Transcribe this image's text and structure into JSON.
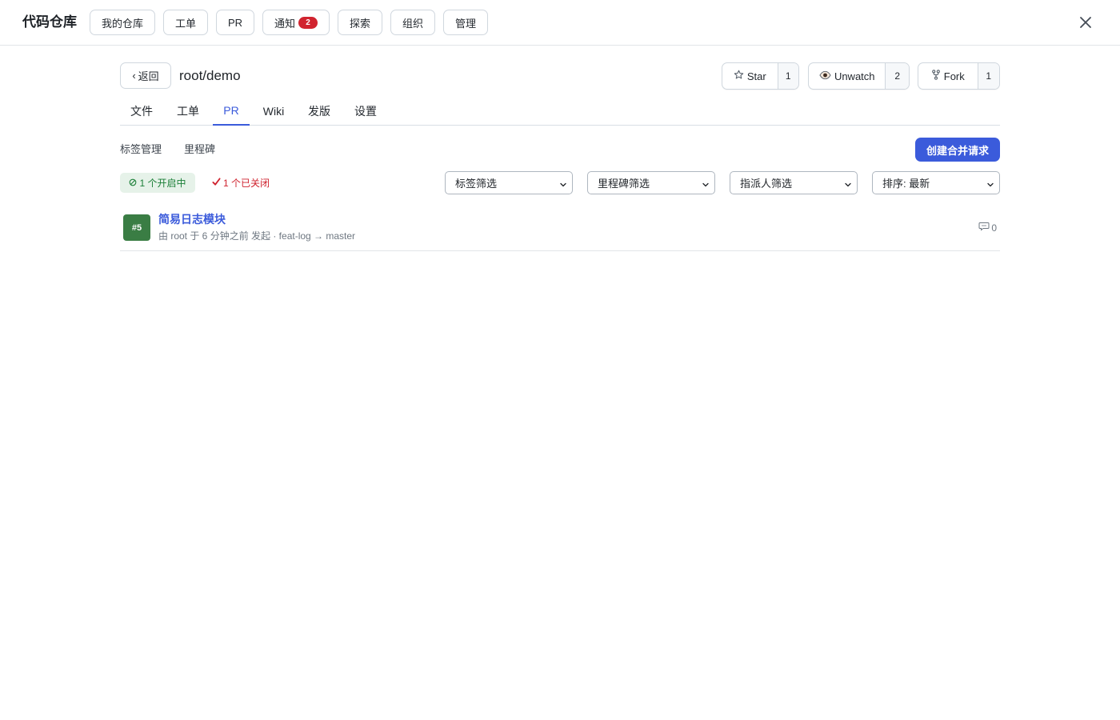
{
  "header": {
    "app_title": "代码仓库",
    "nav": [
      {
        "label": "我的仓库"
      },
      {
        "label": "工单"
      },
      {
        "label": "PR"
      },
      {
        "label": "通知",
        "badge": "2"
      },
      {
        "label": "探索"
      },
      {
        "label": "组织"
      },
      {
        "label": "管理"
      }
    ],
    "close_icon": "close-icon"
  },
  "repo": {
    "back_label": "返回",
    "name": "root/demo",
    "star": {
      "label": "Star",
      "count": "1",
      "icon": "star-icon"
    },
    "watch": {
      "label": "Unwatch",
      "count": "2",
      "icon": "eye-icon"
    },
    "fork": {
      "label": "Fork",
      "count": "1",
      "icon": "fork-icon"
    }
  },
  "tabs": [
    {
      "label": "文件"
    },
    {
      "label": "工单"
    },
    {
      "label": "PR",
      "active": true
    },
    {
      "label": "Wiki"
    },
    {
      "label": "发版"
    },
    {
      "label": "设置"
    }
  ],
  "subnav": {
    "labels_link": "标签管理",
    "milestones_link": "里程碑",
    "create_button": "创建合并请求"
  },
  "filters": {
    "open_status": "1 个开启中",
    "closed_status": "1 个已关闭",
    "selects": [
      {
        "value": "标签筛选"
      },
      {
        "value": "里程碑筛选"
      },
      {
        "value": "指派人筛选"
      },
      {
        "value": "排序: 最新"
      }
    ]
  },
  "pull_requests": [
    {
      "number": "#5",
      "title": "简易日志模块",
      "meta": "由 root 于 6 分钟之前 发起 · feat-log → master",
      "comments": "0"
    }
  ],
  "colors": {
    "accent": "#3b5bdb",
    "open_green": "#1a7f37",
    "closed_red": "#cf222e",
    "badge_red": "#d1242f",
    "avatar_green": "#3a7d44"
  }
}
